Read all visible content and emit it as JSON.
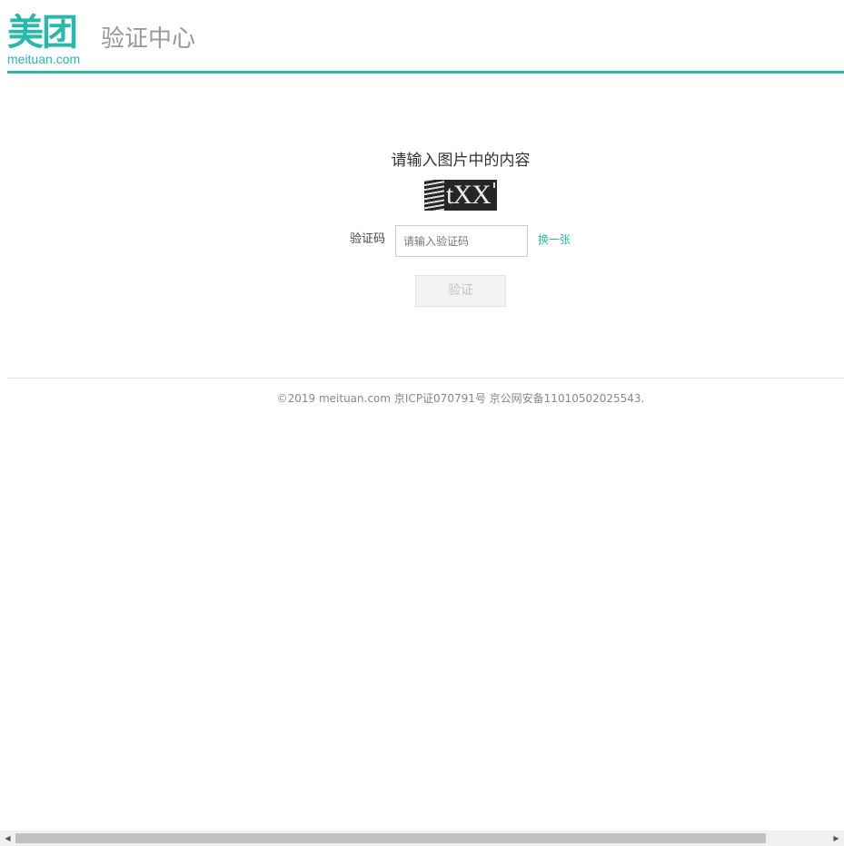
{
  "header": {
    "logo_cn": "美团",
    "logo_en": "meituan.com",
    "title": "验证中心"
  },
  "main": {
    "prompt": "请输入图片中的内容",
    "captcha_text": "tXX",
    "code_label": "验证码",
    "code_input_placeholder": "请输入验证码",
    "code_input_value": "",
    "refresh_label": "换一张",
    "verify_label": "验证"
  },
  "footer": {
    "copyright": "©2019 meituan.com 京ICP证070791号 京公网安备11010502025543."
  },
  "colors": {
    "brand": "#2bb8aa",
    "button_disabled_bg": "#f3f3f3",
    "button_disabled_text": "#c3c3c3"
  },
  "scrollbar": {
    "left_arrow": "◀",
    "right_arrow": "▶"
  }
}
